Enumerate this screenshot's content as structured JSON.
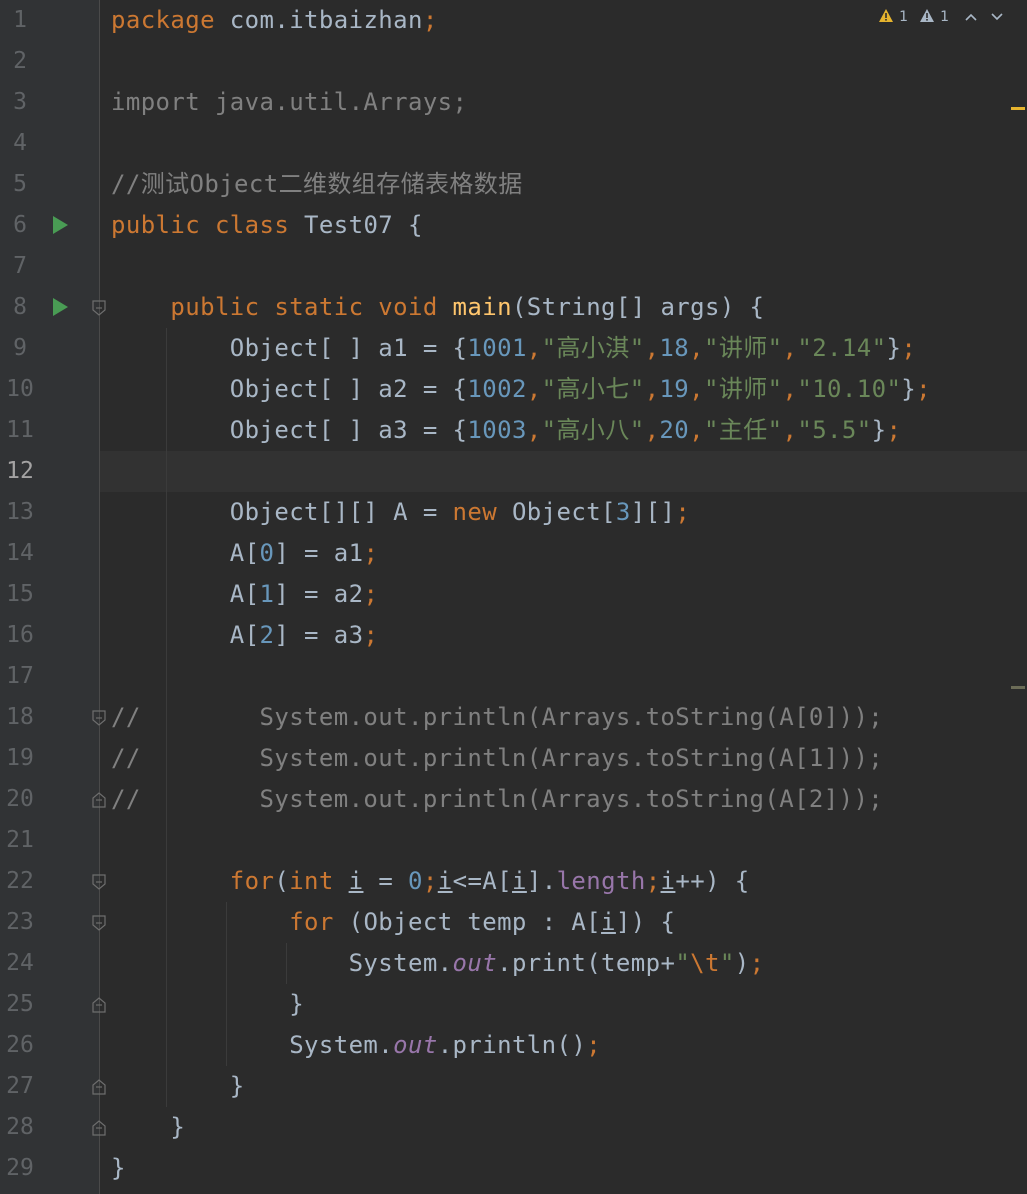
{
  "colors": {
    "background": "#2b2b2b",
    "gutter": "#313335",
    "keyword": "#cc7832",
    "string": "#6a8759",
    "number": "#6897bb",
    "comment": "#808080",
    "method_decl": "#ffc66d",
    "field": "#9876aa",
    "identifier": "#a9b7c6",
    "warning": "#e6b42e",
    "weak_warning": "#a9b7c6",
    "run_marker": "#499c54"
  },
  "inspections": {
    "warning_icon": "warning-triangle-icon",
    "warning_count": "1",
    "weak_warning_icon": "weak-warning-triangle-icon",
    "weak_warning_count": "1",
    "prev_icon": "chevron-up-icon",
    "next_icon": "chevron-down-icon"
  },
  "current_line": 12,
  "lines": [
    {
      "n": "1",
      "tokens": [
        {
          "t": "package ",
          "c": "kw"
        },
        {
          "t": "com.itbaizhan",
          "c": "id"
        },
        {
          "t": ";",
          "c": "kw"
        }
      ]
    },
    {
      "n": "2",
      "tokens": []
    },
    {
      "n": "3",
      "tokens": [
        {
          "t": "import java.util.Arrays;",
          "c": "cmt"
        }
      ]
    },
    {
      "n": "4",
      "tokens": []
    },
    {
      "n": "5",
      "tokens": [
        {
          "t": "//测试Object二维数组存储表格数据",
          "c": "cmt"
        }
      ]
    },
    {
      "n": "6",
      "run": true,
      "tokens": [
        {
          "t": "public class ",
          "c": "kw"
        },
        {
          "t": "Test07 {",
          "c": "id"
        }
      ]
    },
    {
      "n": "7",
      "tokens": []
    },
    {
      "n": "8",
      "run": true,
      "fold": "open",
      "tokens": [
        {
          "t": "    public static void ",
          "c": "kw"
        },
        {
          "t": "main",
          "c": "fn"
        },
        {
          "t": "(String[] args) {",
          "c": "id"
        }
      ]
    },
    {
      "n": "9",
      "tokens": [
        {
          "t": "        Object[ ] a1 = {",
          "c": "id"
        },
        {
          "t": "1001",
          "c": "numlit"
        },
        {
          "t": ",",
          "c": "kw"
        },
        {
          "t": "\"高小淇\"",
          "c": "str"
        },
        {
          "t": ",",
          "c": "kw"
        },
        {
          "t": "18",
          "c": "numlit"
        },
        {
          "t": ",",
          "c": "kw"
        },
        {
          "t": "\"讲师\"",
          "c": "str"
        },
        {
          "t": ",",
          "c": "kw"
        },
        {
          "t": "\"2.14\"",
          "c": "str"
        },
        {
          "t": "}",
          "c": "id"
        },
        {
          "t": ";",
          "c": "kw"
        }
      ]
    },
    {
      "n": "10",
      "tokens": [
        {
          "t": "        Object[ ] a2 = {",
          "c": "id"
        },
        {
          "t": "1002",
          "c": "numlit"
        },
        {
          "t": ",",
          "c": "kw"
        },
        {
          "t": "\"高小七\"",
          "c": "str"
        },
        {
          "t": ",",
          "c": "kw"
        },
        {
          "t": "19",
          "c": "numlit"
        },
        {
          "t": ",",
          "c": "kw"
        },
        {
          "t": "\"讲师\"",
          "c": "str"
        },
        {
          "t": ",",
          "c": "kw"
        },
        {
          "t": "\"10.10\"",
          "c": "str"
        },
        {
          "t": "}",
          "c": "id"
        },
        {
          "t": ";",
          "c": "kw"
        }
      ]
    },
    {
      "n": "11",
      "tokens": [
        {
          "t": "        Object[ ] a3 = {",
          "c": "id"
        },
        {
          "t": "1003",
          "c": "numlit"
        },
        {
          "t": ",",
          "c": "kw"
        },
        {
          "t": "\"高小八\"",
          "c": "str"
        },
        {
          "t": ",",
          "c": "kw"
        },
        {
          "t": "20",
          "c": "numlit"
        },
        {
          "t": ",",
          "c": "kw"
        },
        {
          "t": "\"主任\"",
          "c": "str"
        },
        {
          "t": ",",
          "c": "kw"
        },
        {
          "t": "\"5.5\"",
          "c": "str"
        },
        {
          "t": "}",
          "c": "id"
        },
        {
          "t": ";",
          "c": "kw"
        }
      ]
    },
    {
      "n": "12",
      "tokens": []
    },
    {
      "n": "13",
      "tokens": [
        {
          "t": "        Object[][] A = ",
          "c": "id"
        },
        {
          "t": "new ",
          "c": "kw"
        },
        {
          "t": "Object[",
          "c": "id"
        },
        {
          "t": "3",
          "c": "numlit"
        },
        {
          "t": "][]",
          "c": "id"
        },
        {
          "t": ";",
          "c": "kw"
        }
      ]
    },
    {
      "n": "14",
      "tokens": [
        {
          "t": "        A[",
          "c": "id"
        },
        {
          "t": "0",
          "c": "numlit"
        },
        {
          "t": "] = a1",
          "c": "id"
        },
        {
          "t": ";",
          "c": "kw"
        }
      ]
    },
    {
      "n": "15",
      "tokens": [
        {
          "t": "        A[",
          "c": "id"
        },
        {
          "t": "1",
          "c": "numlit"
        },
        {
          "t": "] = a2",
          "c": "id"
        },
        {
          "t": ";",
          "c": "kw"
        }
      ]
    },
    {
      "n": "16",
      "tokens": [
        {
          "t": "        A[",
          "c": "id"
        },
        {
          "t": "2",
          "c": "numlit"
        },
        {
          "t": "] = a3",
          "c": "id"
        },
        {
          "t": ";",
          "c": "kw"
        }
      ]
    },
    {
      "n": "17",
      "tokens": []
    },
    {
      "n": "18",
      "fold": "open",
      "tokens": [
        {
          "t": "//        System.out.println(Arrays.toString(A[0]));",
          "c": "cmt"
        }
      ]
    },
    {
      "n": "19",
      "tokens": [
        {
          "t": "//        System.out.println(Arrays.toString(A[1]));",
          "c": "cmt"
        }
      ]
    },
    {
      "n": "20",
      "fold": "end",
      "tokens": [
        {
          "t": "//        System.out.println(Arrays.toString(A[2]));",
          "c": "cmt"
        }
      ]
    },
    {
      "n": "21",
      "tokens": []
    },
    {
      "n": "22",
      "fold": "open",
      "tokens": [
        {
          "t": "        for",
          "c": "kw"
        },
        {
          "t": "(",
          "c": "id"
        },
        {
          "t": "int ",
          "c": "kw"
        },
        {
          "t": "i",
          "c": "id u"
        },
        {
          "t": " = ",
          "c": "id"
        },
        {
          "t": "0",
          "c": "numlit"
        },
        {
          "t": ";",
          "c": "kw"
        },
        {
          "t": "i",
          "c": "id u"
        },
        {
          "t": "<=A[",
          "c": "id"
        },
        {
          "t": "i",
          "c": "id u"
        },
        {
          "t": "].",
          "c": "id"
        },
        {
          "t": "length",
          "c": "fld"
        },
        {
          "t": ";",
          "c": "kw"
        },
        {
          "t": "i",
          "c": "id u"
        },
        {
          "t": "++) {",
          "c": "id"
        }
      ]
    },
    {
      "n": "23",
      "fold": "open",
      "tokens": [
        {
          "t": "            for ",
          "c": "kw"
        },
        {
          "t": "(Object temp : A[",
          "c": "id"
        },
        {
          "t": "i",
          "c": "id u"
        },
        {
          "t": "]) {",
          "c": "id"
        }
      ]
    },
    {
      "n": "24",
      "tokens": [
        {
          "t": "                System.",
          "c": "id"
        },
        {
          "t": "out",
          "c": "fld it"
        },
        {
          "t": ".print(temp+",
          "c": "id"
        },
        {
          "t": "\"",
          "c": "str"
        },
        {
          "t": "\\t",
          "c": "kw"
        },
        {
          "t": "\"",
          "c": "str"
        },
        {
          "t": ")",
          "c": "id"
        },
        {
          "t": ";",
          "c": "kw"
        }
      ]
    },
    {
      "n": "25",
      "fold": "end",
      "tokens": [
        {
          "t": "            }",
          "c": "id"
        }
      ]
    },
    {
      "n": "26",
      "tokens": [
        {
          "t": "            System.",
          "c": "id"
        },
        {
          "t": "out",
          "c": "fld it"
        },
        {
          "t": ".println()",
          "c": "id"
        },
        {
          "t": ";",
          "c": "kw"
        }
      ]
    },
    {
      "n": "27",
      "fold": "end",
      "tokens": [
        {
          "t": "        }",
          "c": "id"
        }
      ]
    },
    {
      "n": "28",
      "fold": "end",
      "tokens": [
        {
          "t": "    }",
          "c": "id"
        }
      ]
    },
    {
      "n": "29",
      "tokens": [
        {
          "t": "}",
          "c": "id"
        }
      ]
    }
  ]
}
